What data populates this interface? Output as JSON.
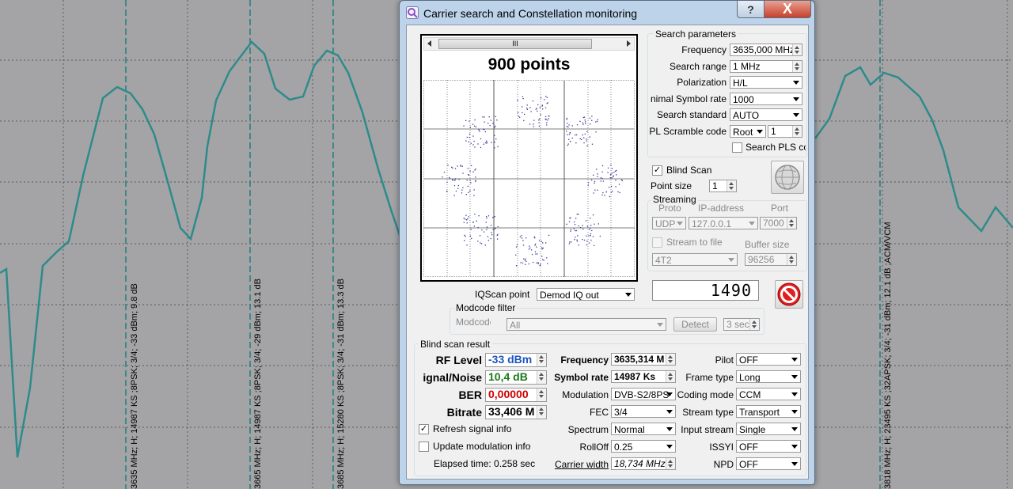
{
  "background": {
    "markers": [
      {
        "label": "3635 MHz; H; 14987 KS ;8PSK; 3/4; -33 dBm; 9.8 dB"
      },
      {
        "label": "3665 MHz; H; 14987 KS ;8PSK; 3/4; -29 dBm; 13.1 dB"
      },
      {
        "label": "3685 MHz; H; 15280 KS ;8PSK; 3/4; -31 dBm; 13.3 dB"
      },
      {
        "label": "3818 MHz; H; 23495 KS ;32APSK; 3/4; -31 dBm; 12.1 dB ;ACM/VCM"
      }
    ],
    "colors": {
      "plot_bg": "#a4a4a6",
      "trace": "#2e8b8b",
      "marker": "#1f7f80",
      "grid": "#5a5a5a"
    }
  },
  "window": {
    "title": "Carrier search and Constellation monitoring",
    "help_label": "?",
    "close_label": "X"
  },
  "constellation": {
    "title": "900 points",
    "scroll_thumb": "III",
    "colors": {
      "dots": "#3a3a9a",
      "grid": "#555555"
    }
  },
  "search": {
    "group_label": "Search parameters",
    "frequency_label": "Frequency",
    "frequency_value": "3635,000 MHz",
    "range_label": "Search range",
    "range_value": "1 MHz",
    "polarization_label": "Polarization",
    "polarization_value": "H/L",
    "min_sr_label": "nimal Symbol rate",
    "min_sr_value": "1000",
    "standard_label": "Search standard",
    "standard_value": "AUTO",
    "pls_label": "PL Scramble code",
    "pls_mode": "Root",
    "pls_value": "1",
    "search_pls_label": "Search PLS cc"
  },
  "blind": {
    "label": "Blind Scan",
    "checked": "✓",
    "point_size_label": "Point size",
    "point_size_value": "1"
  },
  "streaming": {
    "group_label": "Streaming",
    "proto_label": "Proto",
    "ip_label": "IP-address",
    "port_label": "Port",
    "proto_value": "UDP",
    "ip_value": "127.0.0.1",
    "port_value": "7000",
    "stream_to_file_label": "Stream to file",
    "buffer_label": "Buffer size",
    "file_value": "4T2",
    "buffer_value": "96256"
  },
  "counter": "1490",
  "iq": {
    "label": "IQScan point",
    "value": "Demod IQ out"
  },
  "modcode": {
    "group_label": "Modcode filter",
    "label": "Modcode",
    "value": "All",
    "detect_label": "Detect",
    "sec_value": "3 sec"
  },
  "result": {
    "group_label": "Blind scan result",
    "rf_label": "RF Level",
    "rf_value": "-33 dBm",
    "sn_label": "ignal/Noise",
    "sn_value": "10,4 dB",
    "ber_label": "BER",
    "ber_value": "0,00000",
    "bitrate_label": "Bitrate",
    "bitrate_value": "33,406 M",
    "refresh_label": "Refresh signal info",
    "refresh_checked": "✓",
    "update_label": "Update modulation info",
    "elapsed": "Elapsed time: 0.258 sec",
    "frequency_label": "Frequency",
    "frequency_value": "3635,314 M",
    "sr_label": "Symbol rate",
    "sr_value": "14987 Ks",
    "modulation_label": "Modulation",
    "modulation_value": "DVB-S2/8PS",
    "fec_label": "FEC",
    "fec_value": "3/4",
    "spectrum_label": "Spectrum",
    "spectrum_value": "Normal",
    "rolloff_label": "RollOff",
    "rolloff_value": "0.25",
    "carrier_width_label": "Carrier width",
    "carrier_width_value": "18,734 MHz",
    "pilot_label": "Pilot",
    "pilot_value": "OFF",
    "frame_label": "Frame type",
    "frame_value": "Long",
    "coding_label": "Coding mode",
    "coding_value": "CCM",
    "stream_type_label": "Stream type",
    "stream_type_value": "Transport",
    "input_stream_label": "Input stream",
    "input_stream_value": "Single",
    "issyi_label": "ISSYI",
    "issyi_value": "OFF",
    "npd_label": "NPD",
    "npd_value": "OFF"
  }
}
